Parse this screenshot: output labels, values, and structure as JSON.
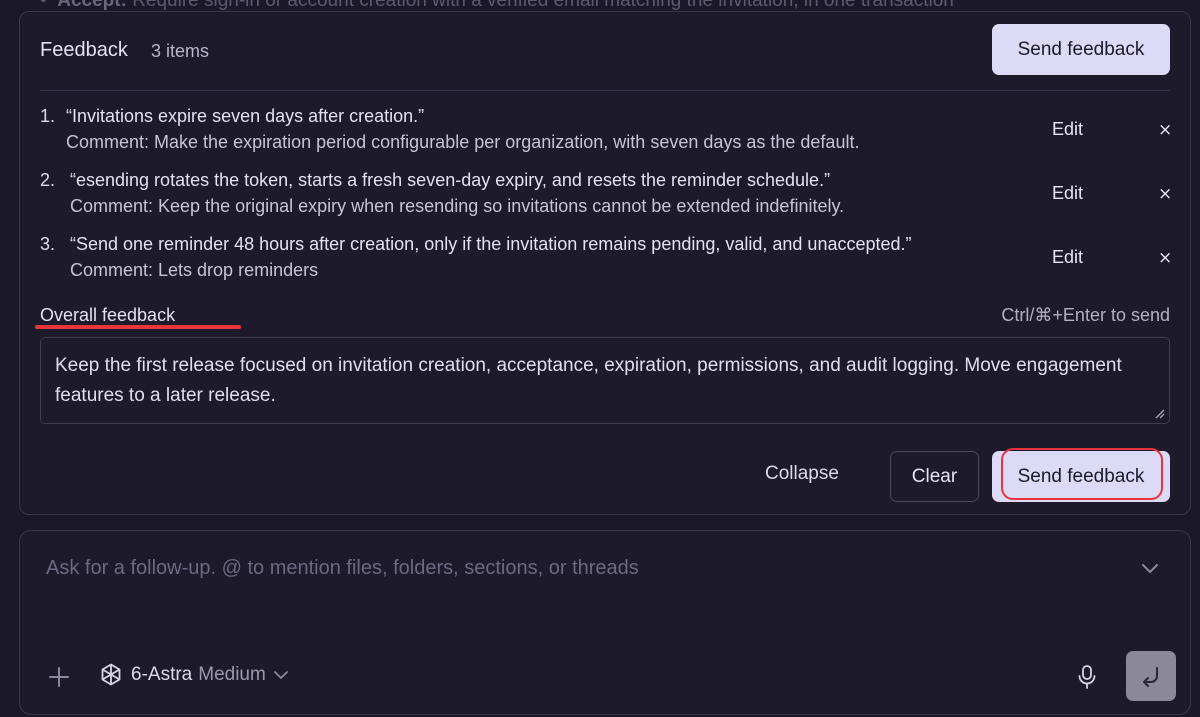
{
  "background": {
    "text_bold": "Accept:",
    "text": "Require sign-in or account creation with a verified email matching the invitation, in one transaction"
  },
  "feedback": {
    "title": "Feedback",
    "count": "3 items",
    "send_top_label": "Send feedback",
    "items": [
      {
        "number": "1.",
        "quote": "“Invitations expire seven days after creation.”",
        "comment": "Comment: Make the expiration period configurable per organization, with seven days as the default.",
        "edit_label": "Edit",
        "remove_label": "×"
      },
      {
        "number": "2.",
        "quote": "“esending rotates the token, starts a fresh seven-day expiry, and resets the reminder schedule.”",
        "comment": "Comment: Keep the original expiry when resending so invitations cannot be extended indefinitely.",
        "edit_label": "Edit",
        "remove_label": "×"
      },
      {
        "number": "3.",
        "quote": "“Send one reminder 48 hours after creation, only if the invitation remains pending, valid, and unaccepted.”",
        "comment": "Comment: Lets drop reminders",
        "edit_label": "Edit",
        "remove_label": "×"
      }
    ],
    "overall_label": "Overall feedback",
    "shortcut_hint": "Ctrl/⌘+Enter to send",
    "overall_text": "Keep the first release focused on invitation creation, acceptance, expiration, permissions, and audit logging. Move engagement features to a later release.",
    "collapse_label": "Collapse",
    "clear_label": "Clear",
    "send_bottom_label": "Send feedback"
  },
  "composer": {
    "placeholder": "Ask for a follow-up. @ to mention files, folders, sections, or threads",
    "model_name": "6-Astra",
    "model_effort": "Medium"
  },
  "icons": {
    "expand": "chevron-down-icon",
    "add": "plus-icon",
    "model": "model-logo-icon",
    "model_dropdown": "chevron-down-icon",
    "mic": "microphone-icon",
    "submit": "return-arrow-icon",
    "resize": "resize-grip-icon"
  },
  "colors": {
    "background": "#1a1829",
    "panel_border": "#3a374b",
    "primary_button": "#dcdaf6",
    "annotation_red": "#e8343a",
    "submit_button": "#8b8998"
  }
}
